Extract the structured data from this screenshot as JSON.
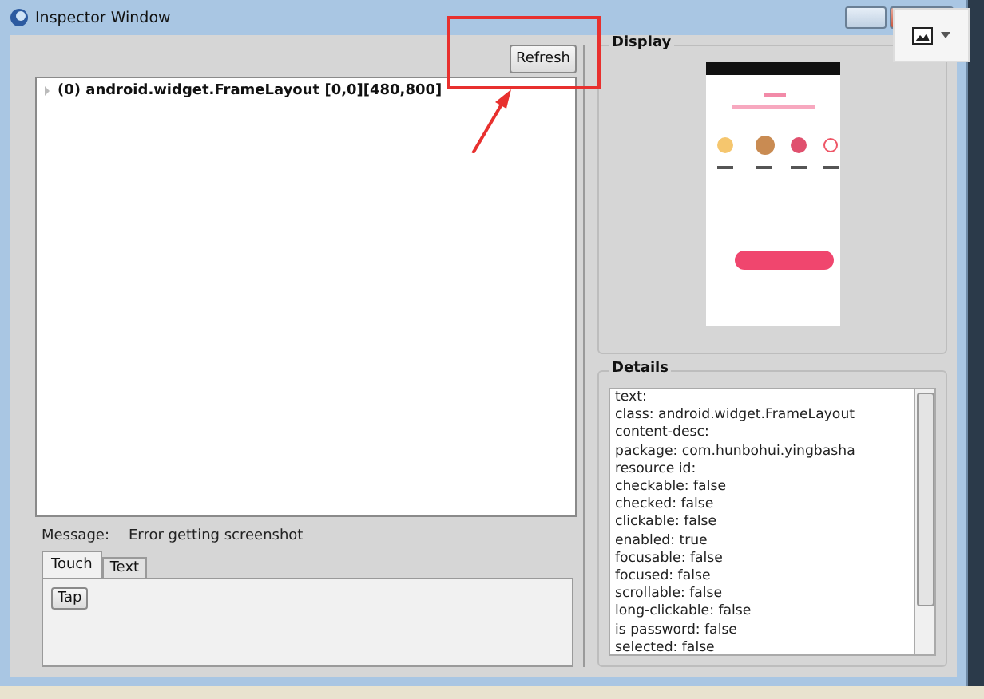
{
  "window": {
    "title": "Inspector Window"
  },
  "refresh_button": "Refresh",
  "tree": {
    "items": [
      {
        "label": "(0) android.widget.FrameLayout [0,0][480,800]",
        "expanded": false
      }
    ]
  },
  "message": {
    "label": "Message:",
    "text": "Error getting screenshot"
  },
  "tabs": [
    {
      "label": "Touch",
      "selected": true
    },
    {
      "label": "Text",
      "selected": false
    }
  ],
  "touch_buttons": [
    "Tap"
  ],
  "display": {
    "title": "Display"
  },
  "details": {
    "title": "Details",
    "lines": [
      "text:",
      "class: android.widget.FrameLayout",
      "content-desc:",
      "package: com.hunbohui.yingbasha",
      "resource id:",
      "checkable: false",
      "checked: false",
      "clickable: false",
      "enabled: true",
      "focusable: false",
      "focused: false",
      "scrollable: false",
      "long-clickable: false",
      "is password: false",
      "selected: false"
    ]
  }
}
